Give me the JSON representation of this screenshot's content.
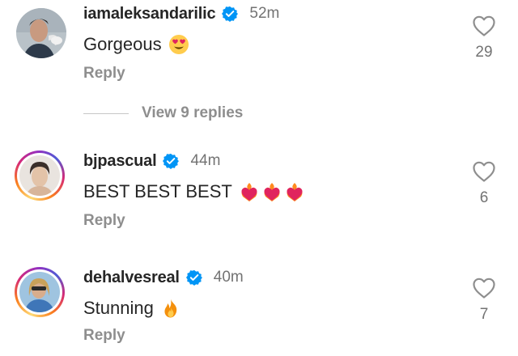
{
  "comments": [
    {
      "username": "iamaleksandarilic",
      "verified": true,
      "time": "52m",
      "text": "Gorgeous",
      "emoji": "heart-eyes-emoji",
      "reply_label": "Reply",
      "like_count": "29",
      "story_ring": false
    },
    {
      "username": "bjpascual",
      "verified": true,
      "time": "44m",
      "text": "BEST BEST BEST",
      "emoji": "heart-on-fire-emoji",
      "reply_label": "Reply",
      "like_count": "6",
      "story_ring": true
    },
    {
      "username": "dehalvesreal",
      "verified": true,
      "time": "40m",
      "text": "Stunning",
      "emoji": "fire-emoji",
      "reply_label": "Reply",
      "like_count": "7",
      "story_ring": true
    }
  ],
  "view_replies_label": "View 9 replies",
  "colors": {
    "verified_blue": "#0095f6",
    "secondary_text": "#737373",
    "primary_text": "#262626"
  }
}
